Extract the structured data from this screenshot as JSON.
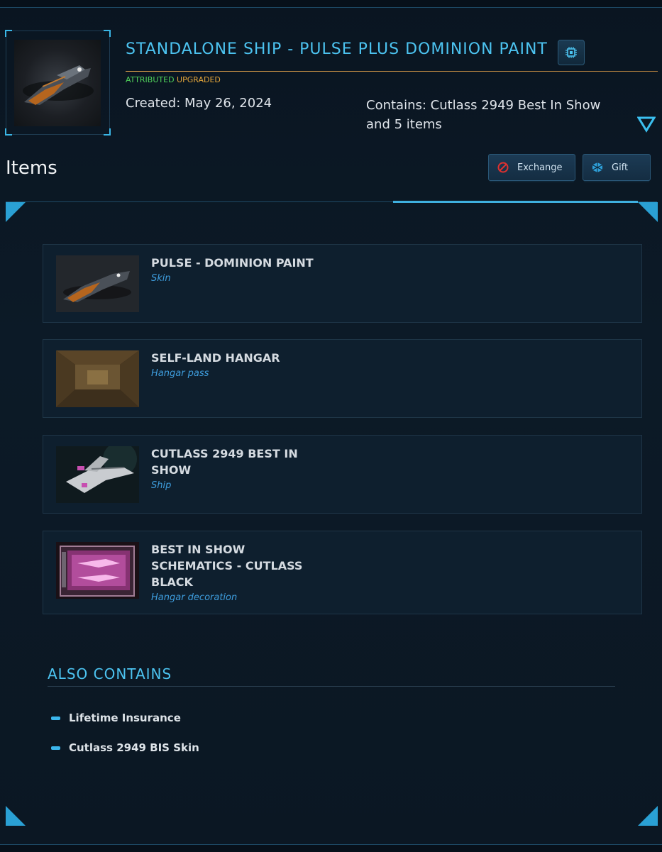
{
  "header": {
    "title": "STANDALONE SHIP - PULSE PLUS DOMINION PAINT",
    "badge_attributed": "ATTRIBUTED",
    "badge_upgraded": "UPGRADED",
    "created": "Created: May 26, 2024",
    "contains": "Contains: Cutlass 2949 Best In Show and 5 items"
  },
  "section_title": "Items",
  "actions": {
    "exchange": "Exchange",
    "gift": "Gift"
  },
  "items": [
    {
      "name": "PULSE - DOMINION PAINT",
      "type": "Skin"
    },
    {
      "name": "SELF-LAND HANGAR",
      "type": "Hangar pass"
    },
    {
      "name": "CUTLASS 2949 BEST IN SHOW",
      "type": "Ship"
    },
    {
      "name": "BEST IN SHOW SCHEMATICS - CUTLASS BLACK",
      "type": "Hangar decoration"
    }
  ],
  "also_contains": {
    "title": "ALSO CONTAINS",
    "items": [
      "Lifetime Insurance",
      "Cutlass 2949 BIS Skin"
    ]
  },
  "colors": {
    "accent": "#4cc3f0",
    "attributed": "#4fd15a",
    "upgraded": "#e3a53a",
    "type_text": "#3e9ddd"
  }
}
